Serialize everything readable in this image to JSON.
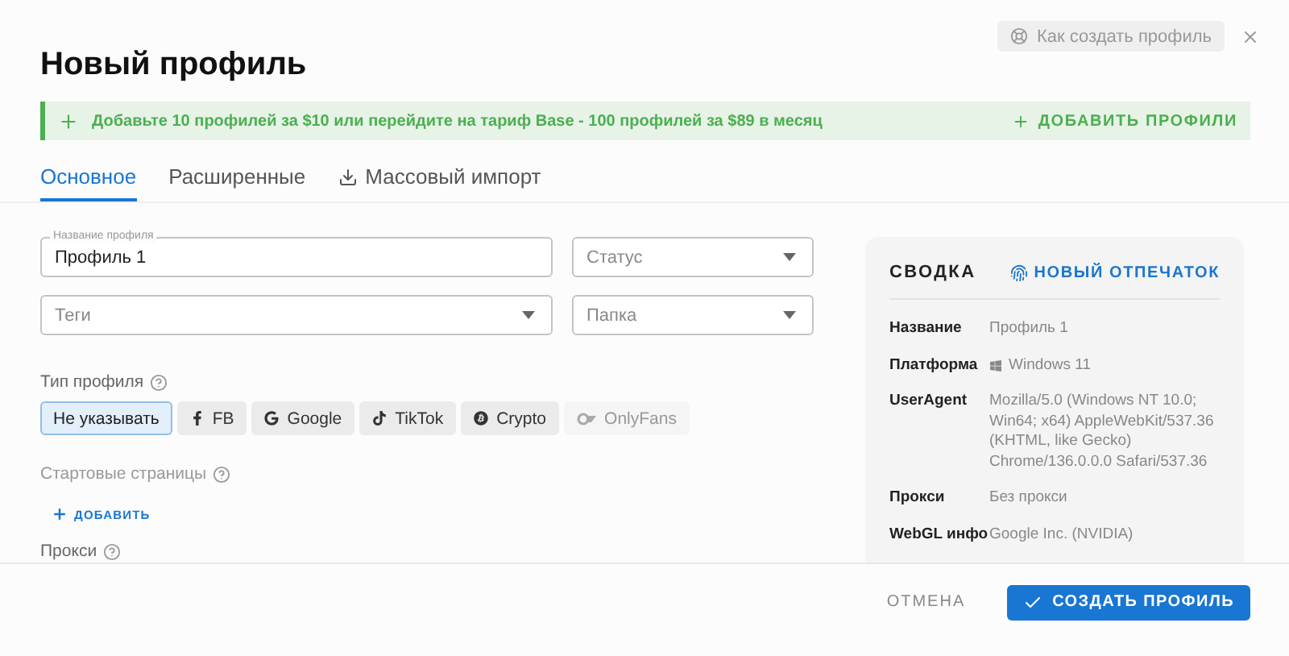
{
  "header": {
    "title": "Новый профиль",
    "help_button": "Как создать профиль"
  },
  "banner": {
    "text": "Добавьте 10 профилей за $10 или перейдите на тариф Base - 100 профилей за $89 в месяц",
    "action": "ДОБАВИТЬ ПРОФИЛИ"
  },
  "tabs": [
    {
      "label": "Основное",
      "selected": true,
      "kind": "plain"
    },
    {
      "label": "Расширенные",
      "selected": false,
      "kind": "plain"
    },
    {
      "label": "Массовый импорт",
      "selected": false,
      "kind": "import"
    }
  ],
  "form": {
    "name_field": {
      "label": "Название профиля",
      "value": "Профиль 1"
    },
    "status_field": {
      "placeholder": "Статус"
    },
    "tags_field": {
      "placeholder": "Теги"
    },
    "folder_field": {
      "placeholder": "Папка"
    }
  },
  "profile_type": {
    "label": "Тип профиля",
    "options": [
      {
        "label": "Не указывать",
        "kind": "none",
        "selected": true,
        "disabled": false
      },
      {
        "label": "FB",
        "kind": "facebook",
        "selected": false,
        "disabled": false
      },
      {
        "label": "Google",
        "kind": "google",
        "selected": false,
        "disabled": false
      },
      {
        "label": "TikTok",
        "kind": "tiktok",
        "selected": false,
        "disabled": false
      },
      {
        "label": "Crypto",
        "kind": "crypto",
        "selected": false,
        "disabled": false
      },
      {
        "label": "OnlyFans",
        "kind": "onlyfans",
        "selected": false,
        "disabled": true
      }
    ]
  },
  "start_pages": {
    "label": "Стартовые страницы",
    "add_button": "ДОБАВИТЬ"
  },
  "proxy": {
    "label": "Прокси"
  },
  "summary": {
    "title": "СВОДКА",
    "action": "НОВЫЙ ОТПЕЧАТОК",
    "rows": [
      {
        "label": "Название",
        "value": "Профиль 1",
        "kind": "text"
      },
      {
        "label": "Платформа",
        "value": "Windows 11",
        "kind": "windows"
      },
      {
        "label": "UserAgent",
        "value": "Mozilla/5.0 (Windows NT 10.0; Win64; x64) AppleWebKit/537.36 (KHTML, like Gecko) Chrome/136.0.0.0 Safari/537.36",
        "kind": "text"
      },
      {
        "label": "Прокси",
        "value": "Без прокси",
        "kind": "text"
      },
      {
        "label": "WebGL инфо",
        "value": "Google Inc. (NVIDIA)",
        "kind": "text"
      }
    ]
  },
  "footer": {
    "cancel": "ОТМЕНА",
    "submit": "СОЗДАТЬ ПРОФИЛЬ"
  }
}
